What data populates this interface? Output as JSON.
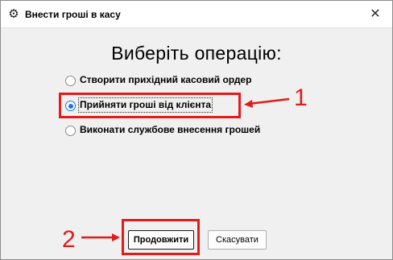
{
  "window": {
    "title": "Внести гроші в касу",
    "icon": "gear-icon",
    "close_glyph": "✕",
    "title_glyph": "⚙"
  },
  "main": {
    "heading": "Виберіть операцію:",
    "options": [
      {
        "label": "Створити прихідний касовий ордер",
        "checked": false
      },
      {
        "label": "Прийняти гроші від клієнта",
        "checked": true
      },
      {
        "label": "Виконати службове внесення грошей",
        "checked": false
      }
    ]
  },
  "buttons": {
    "continue_label": "Продовжити",
    "cancel_label": "Скасувати"
  },
  "annotations": {
    "marker_1": "1",
    "marker_2": "2",
    "color": "#e21b1b"
  }
}
